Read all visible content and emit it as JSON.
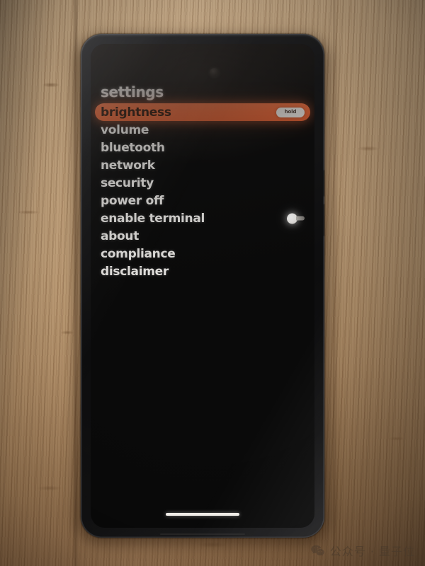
{
  "device": {
    "type": "smartphone",
    "screen_background": "#0a0a0a",
    "body_color": "#151516",
    "camera": "front-camera-punch-hole",
    "buttons": [
      "power-button",
      "volume-button"
    ]
  },
  "screen": {
    "title": "settings",
    "accent_color": "#ef6635",
    "text_color": "#eceae7",
    "selected_index": 0,
    "menu": [
      {
        "label": "brightness",
        "selected": true,
        "badge": "hold",
        "knob": false
      },
      {
        "label": "volume",
        "selected": false,
        "badge": null,
        "knob": false
      },
      {
        "label": "bluetooth",
        "selected": false,
        "badge": null,
        "knob": false
      },
      {
        "label": "network",
        "selected": false,
        "badge": null,
        "knob": false
      },
      {
        "label": "security",
        "selected": false,
        "badge": null,
        "knob": false
      },
      {
        "label": "power off",
        "selected": false,
        "badge": null,
        "knob": false
      },
      {
        "label": "enable terminal",
        "selected": false,
        "badge": null,
        "knob": true
      },
      {
        "label": "about",
        "selected": false,
        "badge": null,
        "knob": false
      },
      {
        "label": "compliance",
        "selected": false,
        "badge": null,
        "knob": false
      },
      {
        "label": "disclaimer",
        "selected": false,
        "badge": null,
        "knob": false
      }
    ],
    "home_indicator": true
  },
  "background": {
    "surface": "wood-desk",
    "surface_color": "#c6a57e"
  },
  "watermark": {
    "icon": "wechat-icon",
    "text": "公众号 · 量子位"
  }
}
